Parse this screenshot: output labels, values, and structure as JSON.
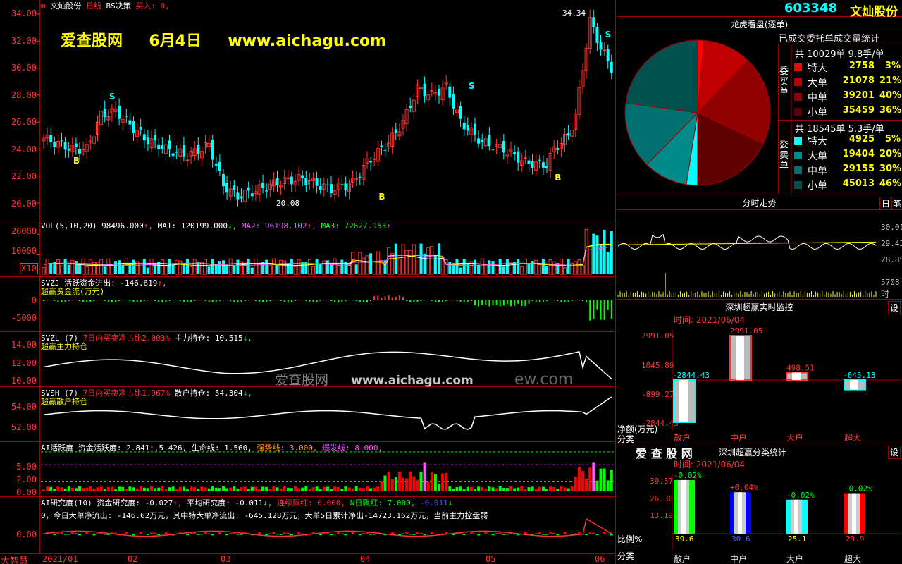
{
  "stock": {
    "code": "603348",
    "name": "文灿股份",
    "title": "文灿股份",
    "period": "日线",
    "strategy": "BS决策",
    "signal": "买入: 0,"
  },
  "watermark": {
    "site": "爱查股网",
    "date": "6月4日",
    "url": "www.aichagu.com",
    "mid": "爱查股网",
    "mid_url": "www.aichagu.com",
    "mid_tail": "ew.com"
  },
  "price_axis": {
    "ticks": [
      "34.00",
      "32.00",
      "30.00",
      "28.00",
      "26.00",
      "24.00",
      "22.00",
      "20.00"
    ],
    "min": 19,
    "max": 35,
    "high_label": "34.34",
    "low_label": "20.08"
  },
  "vol": {
    "header": "VOL(5,10,20)",
    "v": "98496.000",
    "ma1_label": "MA1:",
    "ma1": "120199.000",
    "ma2_label": "MA2:",
    "ma2": "96198.102",
    "ma3_label": "MA3:",
    "ma3": "72627.953",
    "ticks": [
      "20000",
      "10000"
    ],
    "unit": "X10"
  },
  "svzj": {
    "header": "SVZJ",
    "label1": "活跃资金进出:",
    "v1": "-146.619",
    "label2": "超赢资金流(万元)",
    "ticks": [
      "0",
      "-5000"
    ]
  },
  "svzl": {
    "header": "SVZL (7)",
    "label1": "7日内买卖净占比2.003%",
    "label2": "主力持仓:",
    "v2": "10.515",
    "label3": "超赢主力持仓",
    "ticks": [
      "14.00",
      "12.00",
      "10.00"
    ]
  },
  "svsh": {
    "header": "SVSH (7)",
    "label1": "7日内买卖净占比1.967%",
    "label2": "散户持仓:",
    "v2": "54.304",
    "label3": "超赢散户持仓",
    "ticks": [
      "54.00",
      "52.00"
    ]
  },
  "ai1": {
    "header": "AI活跃度",
    "l1": "资金活跃度:",
    "v1": "2.841",
    "v2": "5.426,",
    "l3": "生命线:",
    "v3": "1.560,",
    "l4": "强势线:",
    "v4": "3.000,",
    "l5": "爆发线:",
    "v5": "8.000,",
    "ticks": [
      "5.00",
      "2.00",
      "0.00"
    ]
  },
  "ai2": {
    "header": "AI研究度(10)",
    "l1": "资金研究度:",
    "v1": "-0.027",
    "l2": "平均研究度:",
    "v2": "-0.011",
    "l3": "连续飘红:",
    "v3": "0.000,",
    "l4": "N日飘红:",
    "v4": "7.000,",
    "v5": "-0.011",
    "desc": "0，今日大单净流出: -146.62万元，其中特大单净流出: -645.128万元，大单5日累计净出-14723.162万元，当前主力控盘弱",
    "tick": "0.00"
  },
  "bottom_labels": {
    "corner": "大智慧",
    "dates": [
      "2021/01",
      "02",
      "03",
      "04",
      "05",
      "06"
    ]
  },
  "lhb": {
    "title": "龙虎看盘(逐单)",
    "subtitle": "已成交委托单成交量统计",
    "buy_total": "共 10029单 9.8手/单",
    "buy_side": "委买单",
    "sell_total": "共 18545单 5.3手/单",
    "sell_side": "委卖单",
    "buy_rows": [
      {
        "label": "特大",
        "v": "2758",
        "p": "3%",
        "color": "#ff0000"
      },
      {
        "label": "大单",
        "v": "21078",
        "p": "21%",
        "color": "#c00000"
      },
      {
        "label": "中单",
        "v": "39201",
        "p": "40%",
        "color": "#900000"
      },
      {
        "label": "小单",
        "v": "35459",
        "p": "36%",
        "color": "#600000"
      }
    ],
    "sell_rows": [
      {
        "label": "特大",
        "v": "4925",
        "p": "5%",
        "color": "#00ffff"
      },
      {
        "label": "大单",
        "v": "19404",
        "p": "20%",
        "color": "#008b8b"
      },
      {
        "label": "中单",
        "v": "29155",
        "p": "30%",
        "color": "#007070"
      },
      {
        "label": "小单",
        "v": "45013",
        "p": "46%",
        "color": "#005050"
      }
    ]
  },
  "timeshare": {
    "title": "分时走势",
    "btn1": "日",
    "btn2": "笔",
    "ticks": [
      "30.01",
      "29.43",
      "28.85"
    ],
    "vol_label": "5708",
    "vol_unit": "时"
  },
  "monitor": {
    "title": "深圳超赢实时监控",
    "btn": "设",
    "time": "时间: 2021/06/04",
    "ticks": [
      "2991.05",
      "1045.89",
      "-899.27",
      "-2844.43"
    ],
    "unit": "净额(万元)",
    "cat_label": "分类",
    "cats": [
      "散户",
      "中户",
      "大户",
      "超大"
    ],
    "values": [
      -2844.43,
      2991.05,
      498.51,
      -645.13
    ],
    "labels": [
      "-2844.43",
      "2991.05",
      "498.51",
      "-645.13"
    ]
  },
  "classify": {
    "brand": "爱 查 股 网",
    "title": "深圳超赢分类统计",
    "btn": "设",
    "time": "时间: 2021/06/04",
    "ticks": [
      "39.57",
      "26.38",
      "13.19"
    ],
    "unit": "比例%",
    "cat_label": "分类",
    "cats": [
      "散户",
      "中户",
      "大户",
      "超大"
    ],
    "values": [
      39.6,
      30.6,
      25.1,
      29.9
    ],
    "changes": [
      "-0.02%",
      "+0.04%",
      "-0.02%",
      "-0.02%"
    ],
    "colors": [
      "#00ff00",
      "#0000ff",
      "#00ffff",
      "#ff0000"
    ]
  },
  "chart_data": {
    "type": "candlestick",
    "title": "文灿股份 日线",
    "ylim": [
      19,
      35
    ],
    "x_labels": [
      "2021/01",
      "02",
      "03",
      "04",
      "05",
      "06"
    ],
    "high": 34.34,
    "low": 20.08,
    "pie": {
      "buy": [
        {
          "name": "特大",
          "value": 2758
        },
        {
          "name": "大单",
          "value": 21078
        },
        {
          "name": "中单",
          "value": 39201
        },
        {
          "name": "小单",
          "value": 35459
        }
      ],
      "sell": [
        {
          "name": "特大",
          "value": 4925
        },
        {
          "name": "大单",
          "value": 19404
        },
        {
          "name": "中单",
          "value": 29155
        },
        {
          "name": "小单",
          "value": 45013
        }
      ]
    }
  }
}
